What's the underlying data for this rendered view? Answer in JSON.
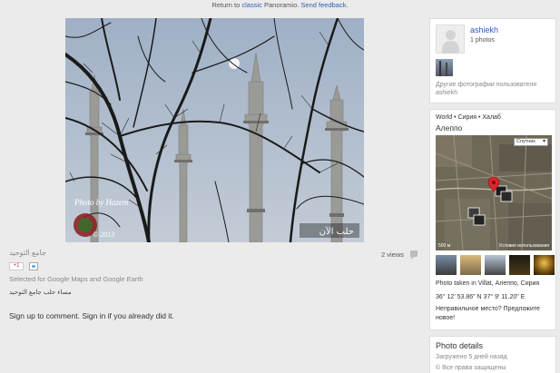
{
  "topbar": {
    "prefix": "Return to ",
    "classic_link": "classic",
    "middle": " Panoramio. ",
    "feedback_link": "Send feedback",
    "suffix": "."
  },
  "photo": {
    "watermark_left": "Photo by Hazem",
    "year": "© 2013",
    "watermark_right": "حلب الآن"
  },
  "photo_info": {
    "title": "جامع التوحيد",
    "gplus_label": "+1",
    "selected": "Selected for Google Maps and Google Earth",
    "description": "مساء حلب جامع التوحيد",
    "views": "2 views",
    "signup": "Sign up to comment. Sign in if you already did it."
  },
  "user": {
    "name": "ashiekh",
    "count": "1 photos",
    "other_photos": "Другие фотографии пользователя",
    "other_user": "ashiekh"
  },
  "location": {
    "breadcrumb": "World • Сирия • Халаб",
    "city": "Алеппо",
    "map_type": "Спутник",
    "scale": "500 м",
    "terms": "Условия использования",
    "taken_in": "Photo taken in Villat, Алеппо, Сирия",
    "coords": "36° 12' 53.86\" N  37° 9' 11.20\" E",
    "wrong_place": "Неправильное место? Предложите новое!"
  },
  "details": {
    "title": "Photo details",
    "uploaded": "Загружено 5 дней назад",
    "rights": "© Все права защищены"
  },
  "colors": {
    "link": "#2a5db0",
    "background": "#ebebeb",
    "sky": "#a9b9cc"
  }
}
